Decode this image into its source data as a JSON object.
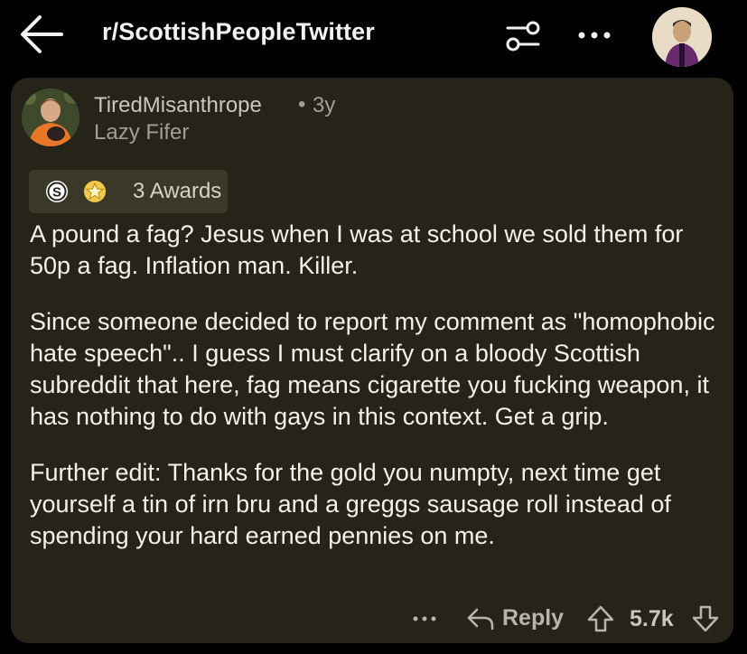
{
  "header": {
    "subreddit": "r/ScottishPeopleTwitter",
    "icons": [
      "back-arrow-icon",
      "filter-sliders-icon",
      "more-dots-icon"
    ]
  },
  "comment": {
    "author": "TiredMisanthrope",
    "separator": "•",
    "age": "3y",
    "flair": "Lazy Fifer",
    "awards": {
      "label": "3 Awards",
      "icons": [
        "silver-award-icon",
        "star-award-icon"
      ]
    },
    "paragraphs": [
      "A pound a fag? Jesus when I was at school we sold them for 50p a fag. Inflation man. Killer.",
      "Since someone decided to report my comment as \"homophobic hate speech\".. I guess I must clarify on a bloody Scottish subreddit that here, fag means cigarette you fucking weapon, it has nothing to do with gays in this context. Get a grip.",
      "Further edit: Thanks for the gold you numpty, next time get yourself a tin of irn bru and a greggs sausage roll instead of spending your hard earned pennies on me."
    ],
    "actions": {
      "reply_label": "Reply",
      "score": "5.7k"
    }
  },
  "colors": {
    "page_background": "#000000",
    "card_background": "#262419",
    "awards_background": "#3a3828",
    "primary_text": "#f3f1ec",
    "muted_text": "#a29e94"
  }
}
